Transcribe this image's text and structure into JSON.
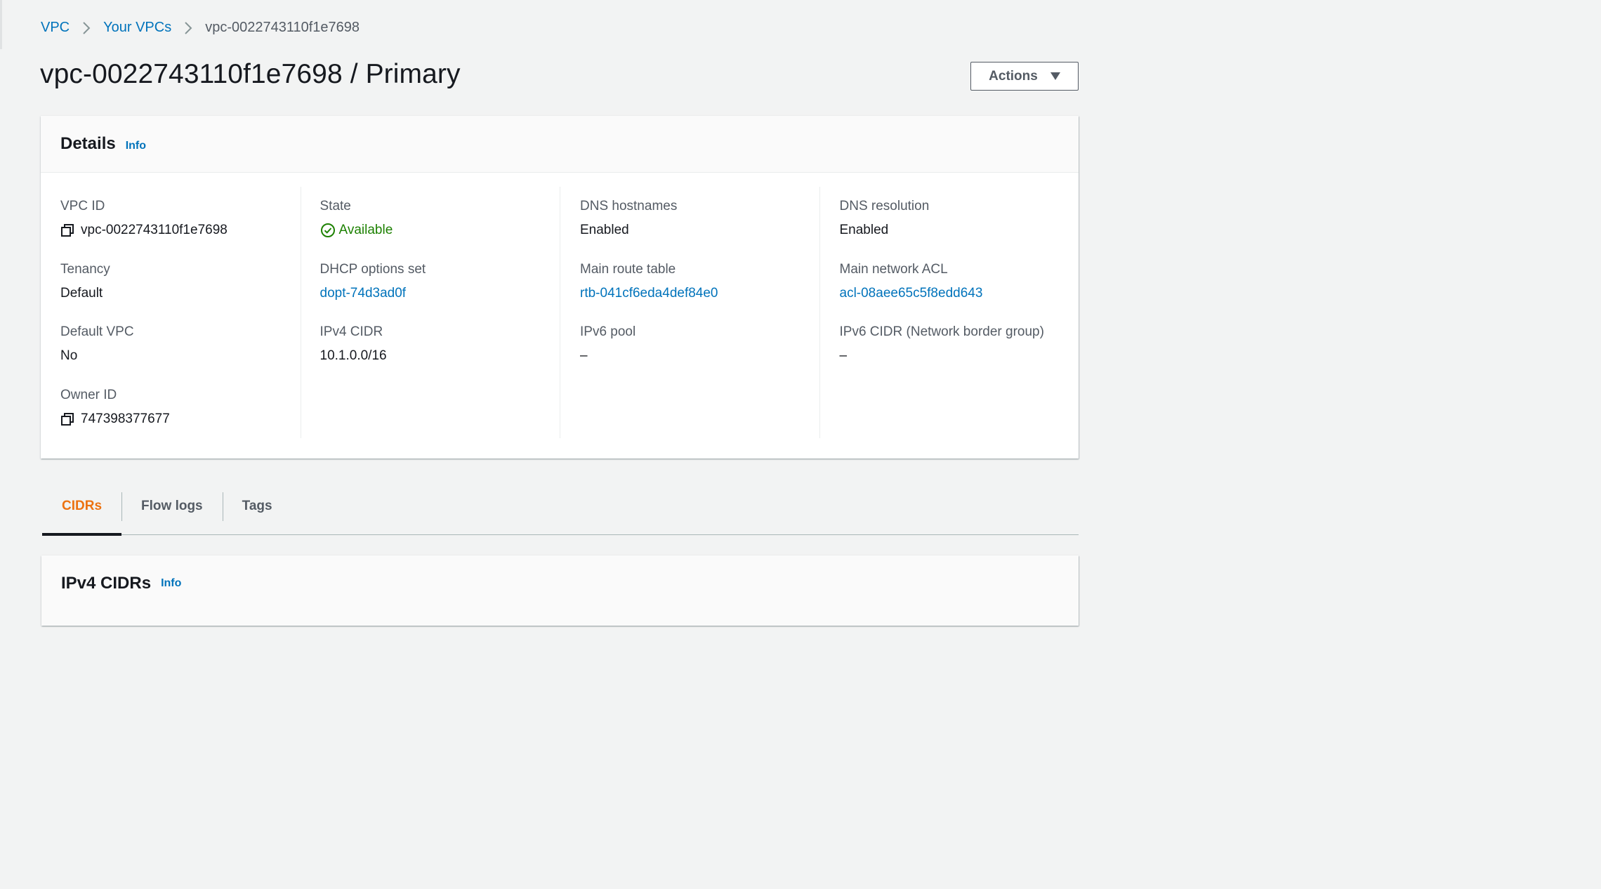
{
  "breadcrumb": {
    "items": [
      {
        "label": "VPC"
      },
      {
        "label": "Your VPCs"
      },
      {
        "label": "vpc-0022743110f1e7698"
      }
    ]
  },
  "page": {
    "title": "vpc-0022743110f1e7698 / Primary",
    "actions_label": "Actions"
  },
  "details": {
    "title": "Details",
    "info_label": "Info",
    "vpc_id": {
      "label": "VPC ID",
      "value": "vpc-0022743110f1e7698"
    },
    "tenancy": {
      "label": "Tenancy",
      "value": "Default"
    },
    "default_vpc": {
      "label": "Default VPC",
      "value": "No"
    },
    "owner_id": {
      "label": "Owner ID",
      "value": "747398377677"
    },
    "state": {
      "label": "State",
      "value": "Available"
    },
    "dhcp_options_set": {
      "label": "DHCP options set",
      "value": "dopt-74d3ad0f"
    },
    "ipv4_cidr": {
      "label": "IPv4 CIDR",
      "value": "10.1.0.0/16"
    },
    "dns_hostnames": {
      "label": "DNS hostnames",
      "value": "Enabled"
    },
    "main_route_table": {
      "label": "Main route table",
      "value": "rtb-041cf6eda4def84e0"
    },
    "ipv6_pool": {
      "label": "IPv6 pool",
      "value": "–"
    },
    "dns_resolution": {
      "label": "DNS resolution",
      "value": "Enabled"
    },
    "main_network_acl": {
      "label": "Main network ACL",
      "value": "acl-08aee65c5f8edd643"
    },
    "ipv6_cidr": {
      "label": "IPv6 CIDR (Network border group)",
      "value": "–"
    }
  },
  "tabs": [
    {
      "label": "CIDRs",
      "active": true
    },
    {
      "label": "Flow logs",
      "active": false
    },
    {
      "label": "Tags",
      "active": false
    }
  ],
  "ipv4_cidrs": {
    "title": "IPv4 CIDRs",
    "info_label": "Info"
  },
  "colors": {
    "link": "#0073bb",
    "success": "#1d8102",
    "active_tab": "#ec7211",
    "text": "#16191f",
    "label": "#545b64",
    "background": "#f2f3f3"
  },
  "icons": {
    "breadcrumb_separator": "chevron-right-icon",
    "actions_caret": "caret-down-icon",
    "copy": "copy-icon",
    "status": "check-circle-icon"
  }
}
